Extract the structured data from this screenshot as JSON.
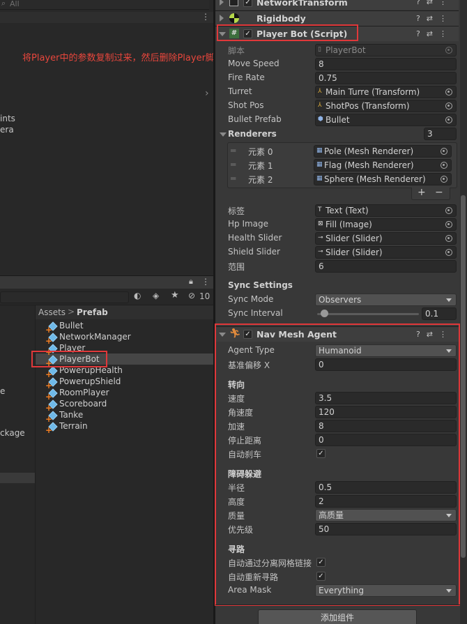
{
  "hierarchy": {
    "search_placeholder": "All",
    "partial_items": [
      "ints",
      "era"
    ]
  },
  "project": {
    "breadcrumb_root": "Assets",
    "breadcrumb_sep": ">",
    "breadcrumb_current": "Prefab",
    "hidden_count": "10",
    "left_partial": [
      "e",
      "ckage"
    ],
    "files": [
      "Bullet",
      "NetworkManager",
      "Player",
      "PlayerBot",
      "PowerupHealth",
      "PowerupShield",
      "RoomPlayer",
      "Scoreboard",
      "Tanke",
      "Terrain"
    ]
  },
  "annotation": "将Player中的参数复制过来，然后删除Player脚本",
  "components": {
    "network_transform": "NetworkTransform",
    "rigidbody": "Rigidbody",
    "player_bot": "Player Bot (Script)",
    "nav_mesh_agent": "Nav Mesh Agent"
  },
  "player_bot": {
    "script_label": "脚本",
    "script_value": "PlayerBot",
    "move_speed_label": "Move Speed",
    "move_speed": "8",
    "fire_rate_label": "Fire Rate",
    "fire_rate": "0.75",
    "turret_label": "Turret",
    "turret": "Main Turre (Transform)",
    "shot_pos_label": "Shot Pos",
    "shot_pos": "ShotPos (Transform)",
    "bullet_prefab_label": "Bullet Prefab",
    "bullet_prefab": "Bullet",
    "renderers_label": "Renderers",
    "renderers_count": "3",
    "renderers": [
      {
        "label": "元素 0",
        "value": "Pole (Mesh Renderer)"
      },
      {
        "label": "元素 1",
        "value": "Flag (Mesh Renderer)"
      },
      {
        "label": "元素 2",
        "value": "Sphere (Mesh Renderer)"
      }
    ],
    "plus": "+",
    "minus": "−",
    "tag_label": "标签",
    "tag": "Text (Text)",
    "hp_image_label": "Hp Image",
    "hp_image": "Fill (Image)",
    "health_slider_label": "Health Slider",
    "health_slider": "Slider (Slider)",
    "shield_slider_label": "Shield Slider",
    "shield_slider": "Slider (Slider)",
    "range_label": "范围",
    "range": "6",
    "sync_settings_label": "Sync Settings",
    "sync_mode_label": "Sync Mode",
    "sync_mode": "Observers",
    "sync_interval_label": "Sync Interval",
    "sync_interval": "0.1",
    "sync_interval_fraction": 0.07
  },
  "nav_mesh_agent": {
    "agent_type_label": "Agent Type",
    "agent_type": "Humanoid",
    "base_offset_label": "基准偏移 X",
    "base_offset": "0",
    "steering_label": "转向",
    "speed_label": "速度",
    "speed": "3.5",
    "angular_speed_label": "角速度",
    "angular_speed": "120",
    "acceleration_label": "加速",
    "acceleration": "8",
    "stopping_distance_label": "停止距离",
    "stopping_distance": "0",
    "auto_braking_label": "自动刹车",
    "obstacle_label": "障碍躲避",
    "radius_label": "半径",
    "radius": "0.5",
    "height_label": "高度",
    "height": "2",
    "quality_label": "质量",
    "quality": "高质量",
    "priority_label": "优先级",
    "priority": "50",
    "pathfinding_label": "寻路",
    "auto_traverse_label": "自动通过分离网格链接",
    "auto_repath_label": "自动重新寻路",
    "area_mask_label": "Area Mask",
    "area_mask": "Everything"
  },
  "add_component": "添加组件",
  "colors": {
    "highlight": "#e0383a",
    "annotation": "#e8463c",
    "accent": "#6fb9e8"
  }
}
